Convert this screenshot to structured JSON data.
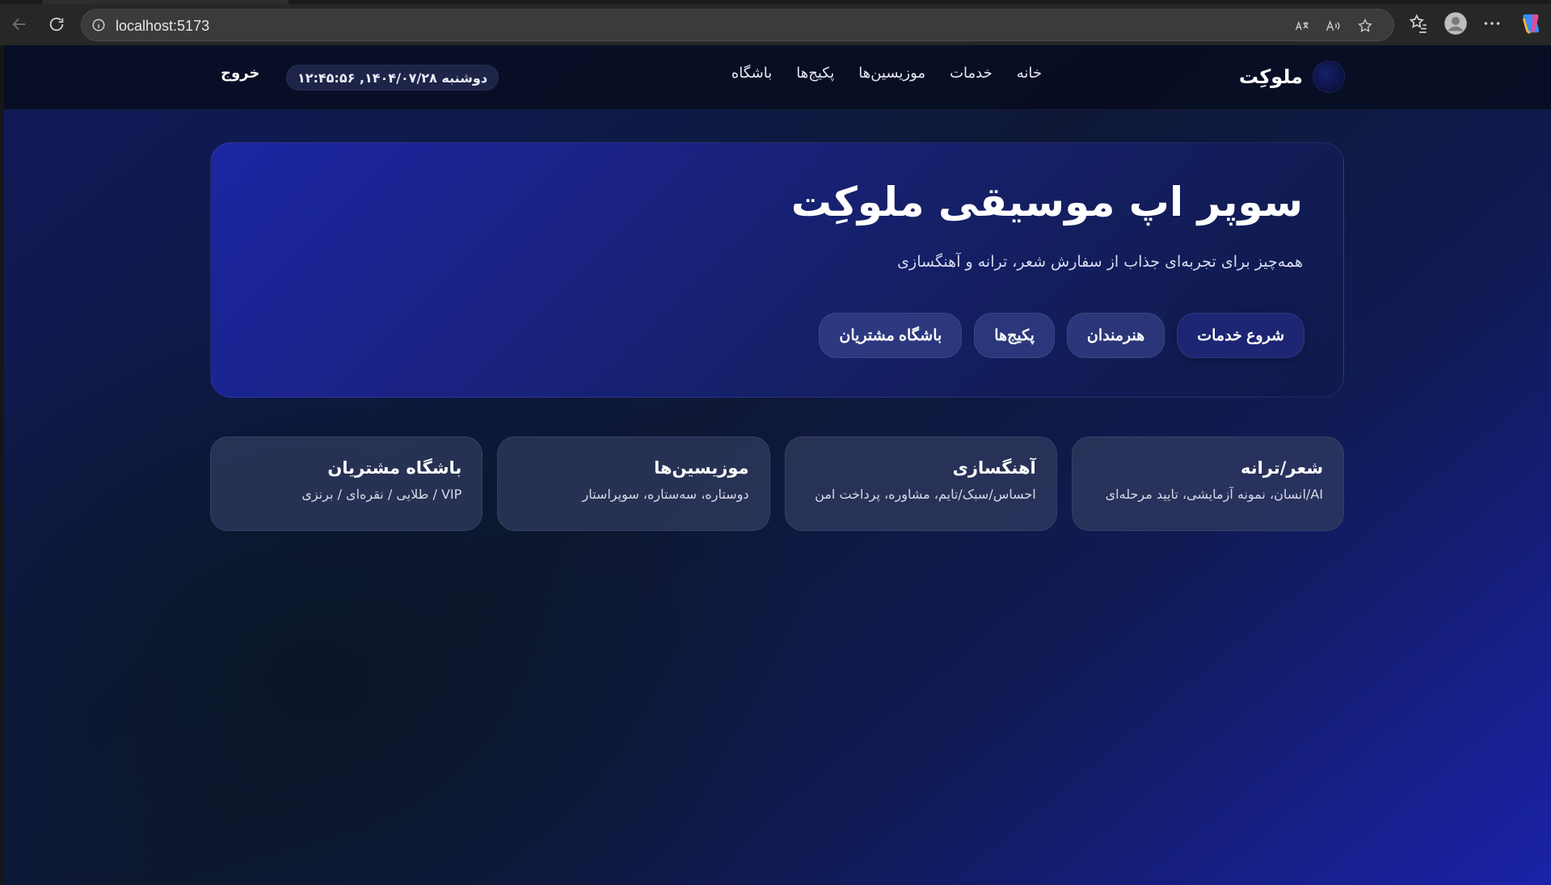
{
  "browser": {
    "url": "localhost:5173"
  },
  "header": {
    "brand": "ملوکِت",
    "nav": [
      "خانه",
      "خدمات",
      "موزیسین‌ها",
      "پکیج‌ها",
      "باشگاه"
    ],
    "datetime": "دوشنبه ۱۴۰۴/۰۷/۲۸, ۱۲:۴۵:۵۶",
    "logout": "خروج"
  },
  "hero": {
    "title": "سوپر اپ موسیقی ملوکِت",
    "subtitle": "همه‌چیز برای تجربه‌ای جذاب از سفارش شعر، ترانه و آهنگسازی",
    "buttons": [
      "شروع خدمات",
      "هنرمندان",
      "پکیج‌ها",
      "باشگاه مشتریان"
    ]
  },
  "cards": [
    {
      "title": "شعر/ترانه",
      "desc": "AI/انسان، نمونه آزمایشی، تایید مرحله‌ای"
    },
    {
      "title": "آهنگسازی",
      "desc": "احساس/سبک/تایم، مشاوره، پرداخت امن"
    },
    {
      "title": "موزیسین‌ها",
      "desc": "دوستاره، سه‌ستاره، سوپراستار"
    },
    {
      "title": "باشگاه مشتریان",
      "desc": "VIP / طلایی / نقره‌ای / برنزی"
    }
  ]
}
